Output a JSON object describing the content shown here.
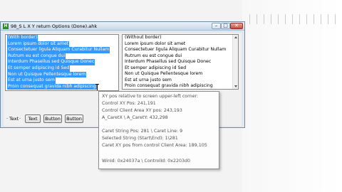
{
  "window": {
    "icon_letter": "H",
    "title": "98_S L X Y return Options (Done).ahk",
    "min_glyph": "–",
    "max_glyph": "□",
    "close_glyph": "✕"
  },
  "left_edit": {
    "lines": [
      "(With border)",
      "Lorem ipsum dolor sit amet",
      "Consectetuer ligula Aliquam Curabitur Nullam",
      "Rutrum eu est congue dui",
      "Interdum Phasellus sed Quisque Donec",
      "Et semper adipiscing id Sed",
      "Non ut Quisque Pellentesque lorem",
      "Est at urna justo sem",
      "Proin consequat gravida nibh adipiscing"
    ]
  },
  "right_edit": {
    "lines": [
      "(Without border)",
      "Lorem ipsum dolor sit amet",
      "Consectetuer ligula Aliquam Curabitur Nullam",
      "Rutrum eu est congue dui",
      "Interdum Phasellus sed Quisque Donec",
      "Et semper adipiscing id Sed",
      "Non ut Quisque Pellentesque lorem",
      "Est at urna justo sem",
      "Proin consequat gravida nibh adipiscing"
    ]
  },
  "controls": {
    "label_1": "Text",
    "button_1": "Text",
    "button_2": "Button",
    "button_3": "Button"
  },
  "tooltip": {
    "lines": [
      "XY pos relative to screen upper-left corner:",
      "Control XY Pos: 241,191",
      "Control Client Area XY pos: 243,193",
      "A_CaretX \\ A_CaretY: 432,298",
      "",
      "Caret String Pos: 281 \\ Caret Line: 9",
      "Selected String (Start\\End): 1\\281",
      "Caret XY pos from control Client Area: 189,105",
      "",
      "WinId: 0x24037a \\ ControlId: 0x2203d0"
    ]
  }
}
